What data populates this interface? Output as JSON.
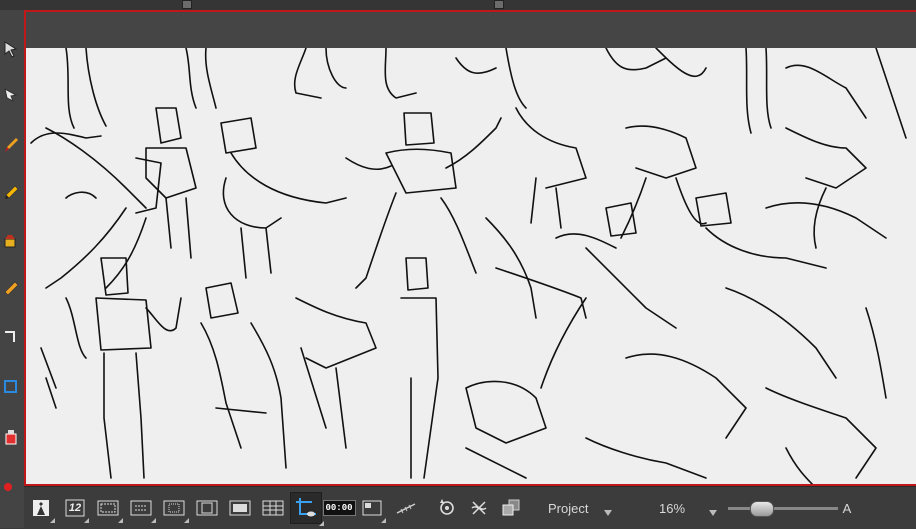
{
  "left_toolbar": {
    "tools": [
      {
        "icon": "select-arrow-icon"
      },
      {
        "icon": "contour-editor-icon"
      },
      {
        "icon": "brush-icon"
      },
      {
        "icon": "pencil-icon"
      },
      {
        "icon": "paint-bucket-icon"
      },
      {
        "icon": "cutter-icon"
      },
      {
        "icon": "rectangle-tool-icon"
      },
      {
        "icon": "stroke-icon"
      },
      {
        "icon": "ink-pot-icon"
      },
      {
        "icon": "color-dot-icon"
      }
    ]
  },
  "bottom_bar": {
    "timecode": "00:00",
    "frame_label": "12",
    "view_mode": "Project",
    "zoom": "16%",
    "slider_end_label": "A",
    "slider_level": 0.25
  },
  "colors": {
    "accent_red": "#c01818",
    "canvas_bg": "#efefef",
    "toolbar_bg": "#3c3c3c"
  }
}
